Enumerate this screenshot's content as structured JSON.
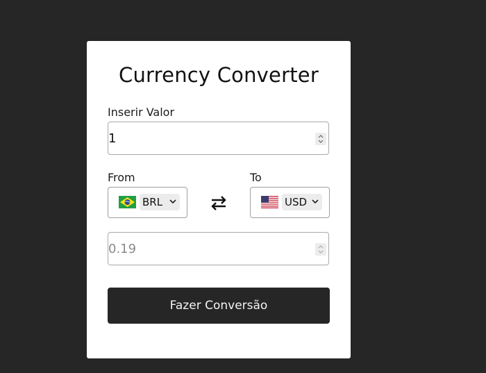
{
  "header": {
    "title": "Currency Converter"
  },
  "amount": {
    "label": "Inserir Valor",
    "value": "1"
  },
  "from": {
    "label": "From",
    "currency": "BRL",
    "flag": "brazil-flag-icon"
  },
  "to": {
    "label": "To",
    "currency": "USD",
    "flag": "usa-flag-icon"
  },
  "swap_icon": "swap-arrows-icon",
  "result": {
    "value": "0.19"
  },
  "convert_button": {
    "label": "Fazer Conversão"
  },
  "colors": {
    "background": "#262626",
    "card": "#ffffff",
    "button": "#262626",
    "button_text": "#f4f4f4"
  }
}
